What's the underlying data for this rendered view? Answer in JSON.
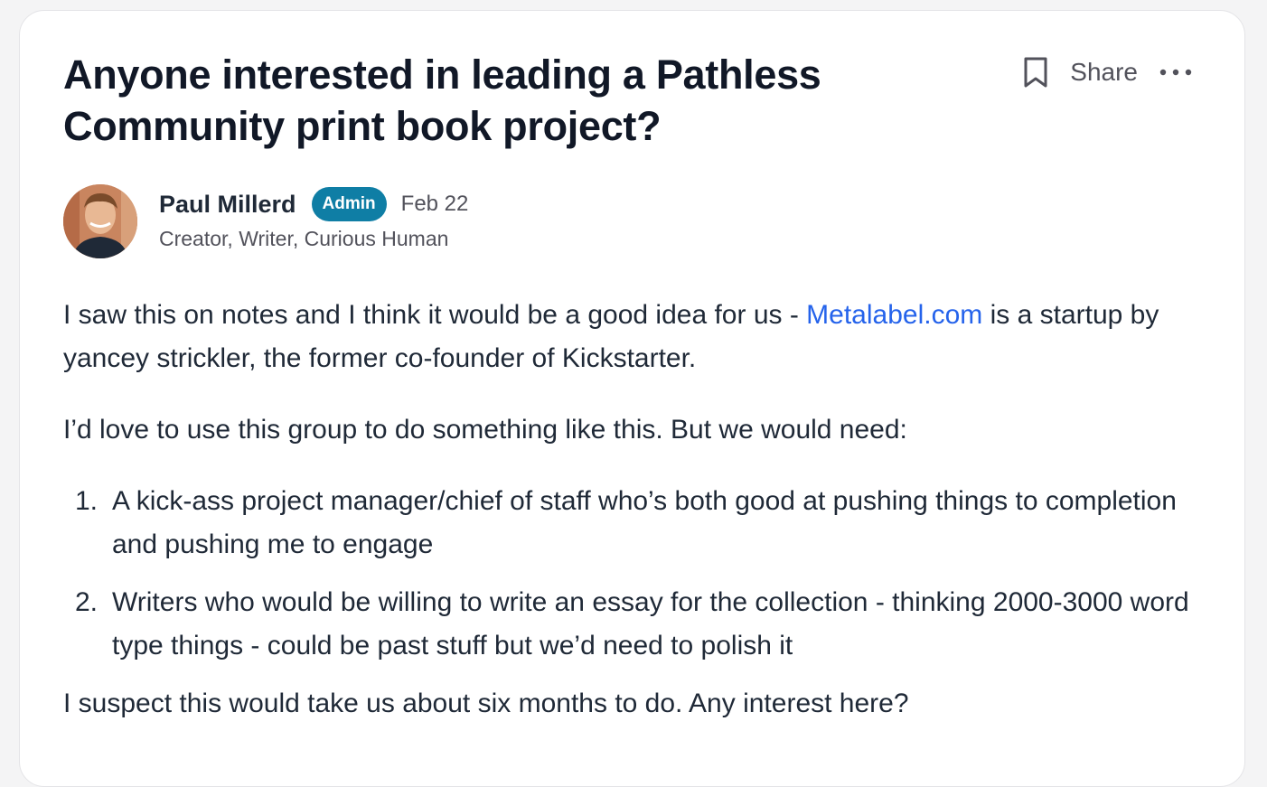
{
  "post": {
    "title": "Anyone interested in leading a Pathless Community print book project?",
    "share_label": "Share",
    "author": {
      "name": "Paul Millerd",
      "badge": "Admin",
      "date": "Feb 22",
      "bio": "Creator, Writer, Curious Human"
    },
    "body": {
      "p1_before_link": "I saw this on notes and I think it would be a good idea for us - ",
      "link_text": "Metalabel.com",
      "p1_after_link": " is a startup by yancey strickler, the former co-founder of Kickstarter.",
      "p2": "I’d love to use this group to do something like this. But we would need:",
      "list": [
        {
          "number": "1.",
          "text": "A kick-ass project manager/chief of staff who’s both good at pushing things to completion and pushing me to engage"
        },
        {
          "number": "2.",
          "text": "Writers who would be willing to write an essay for the collection - thinking 2000-3000 word type things - could be past stuff but we’d need to polish it"
        }
      ],
      "p3": "I suspect this would take us about six months to do. Any interest here?"
    }
  },
  "icons": {
    "bookmark": "bookmark-icon",
    "more": "more-horizontal-icon"
  },
  "colors": {
    "badge": "#0f7ea5",
    "link": "#2563eb",
    "text": "#1f2937",
    "muted": "#52525b"
  }
}
